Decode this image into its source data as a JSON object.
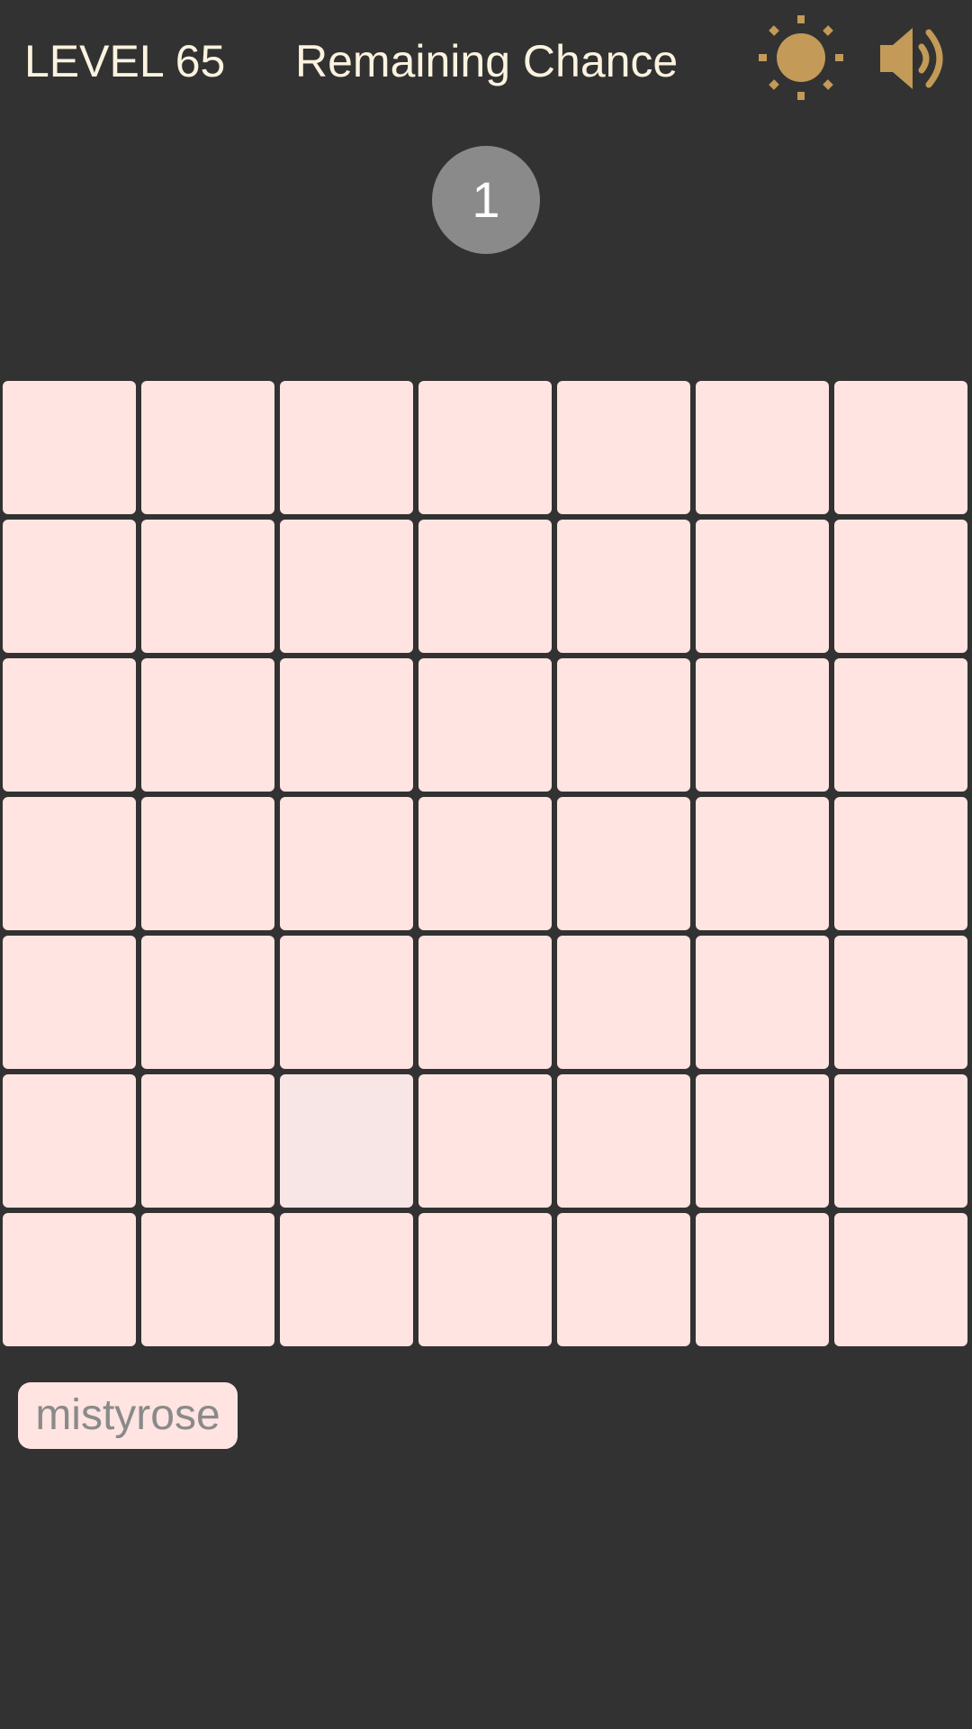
{
  "header": {
    "level_label": "LEVEL 65",
    "remaining_label": "Remaining Chance",
    "brightness_icon": "sun-icon",
    "sound_icon": "speaker-icon",
    "icon_color": "#c39a57"
  },
  "chances": {
    "count": "1"
  },
  "board": {
    "rows": 7,
    "columns": 7,
    "base_color": "#ffe4e1",
    "odd_color": "#f8e6e6",
    "odd_cell": {
      "row": 6,
      "column": 3
    }
  },
  "answer_chip": {
    "label": "mistyrose",
    "background": "#ffe4e1",
    "text_color": "#8a8a8a"
  },
  "colors": {
    "background": "#323232",
    "header_text": "#fbf3df",
    "badge": "#8a8a8a"
  }
}
